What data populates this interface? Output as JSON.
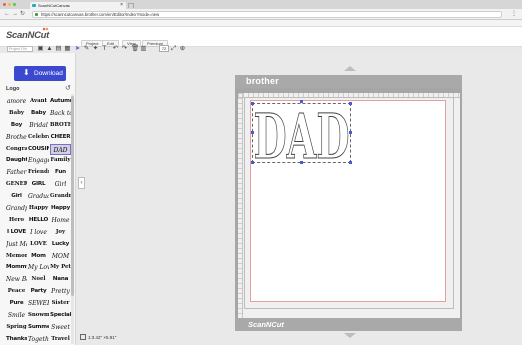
{
  "browser": {
    "tab_title": "ScanNCutCanvas",
    "url": "https://scanncutcanvas.brother.com/en/Editor/Index?mode=new",
    "bookmarks": [
      "Apps",
      "Listening",
      "Bookmarks",
      "Ty pic tidy",
      "Add to US aff link",
      "Rent",
      "Etsy",
      "BFH Admin",
      "Bookkeeping",
      "Dropcam",
      "Event Time Announ",
      "ScoreKeeper",
      "Pinterest",
      "Banger Apps",
      "Hashtags",
      "BBYS Part A",
      "NYS Urban Batch",
      "Pandora Radio",
      "Pinterest",
      "Other"
    ]
  },
  "app": {
    "logo_text": "ScanNCut",
    "menus": [
      "Project",
      "Edit",
      "View",
      "Premium"
    ],
    "project_file_placeholder": "Project File",
    "size_value": "72"
  },
  "sidebar": {
    "download_label": "Download",
    "category": "Logo",
    "items": [
      "amore",
      "Avant",
      "Autumn",
      "Baby",
      "Baby",
      "Back to School",
      "Boy",
      "Bridal",
      "BROTHER",
      "Brothers",
      "Celebrate",
      "CHEER",
      "Congratulations",
      "COUSIN",
      "DAD",
      "Daughter",
      "Engagement",
      "Family",
      "Father",
      "Friends",
      "Fun",
      "GENERATIONS",
      "GIRL",
      "Girl",
      "Girl",
      "Graduate",
      "Grandma",
      "Grandpa",
      "Happy",
      "Happy",
      "Hero",
      "HELLO",
      "Home",
      "I LOVE",
      "I love",
      "Joy",
      "Just Married",
      "LOVE",
      "Lucky",
      "Memories",
      "Mom",
      "MOM",
      "Mommy",
      "My Love",
      "My Pet",
      "New Baby",
      "Noel",
      "Nana",
      "Peace",
      "Party",
      "Pretty",
      "Pure",
      "SEWER",
      "Sister",
      "Smile",
      "Snowman",
      "Special",
      "Spring",
      "Summer",
      "Sweet",
      "Thanks",
      "Together",
      "Travel"
    ],
    "selected_index": 14
  },
  "canvas": {
    "mat_brand": "brother",
    "mat_footer": "ScanNCut",
    "design_text": "DAD"
  },
  "status": {
    "dimensions": "1:3.42\" ×5.91\""
  }
}
